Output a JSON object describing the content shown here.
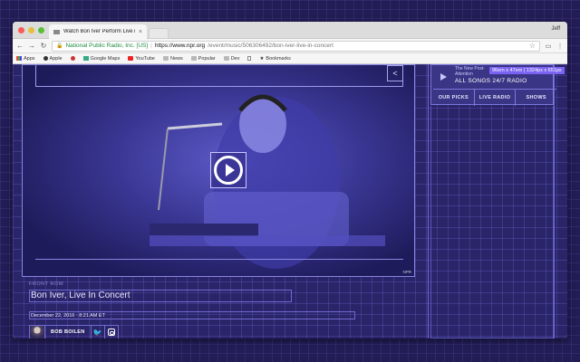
{
  "browser": {
    "tab_title": "Watch Bon Iver Perform Live i",
    "tab_close": "×",
    "user": "Jeff",
    "secure_label": "National Public Radio, Inc. [US]",
    "url_separator": "|",
    "url_host": "https://www.npr.org",
    "url_path": "/event/music/506306492/bon-iver-live-in-concert",
    "bookmarks": [
      {
        "label": "Apps",
        "icon": "apps-icon"
      },
      {
        "label": "Apple",
        "icon": "apple-icon"
      },
      {
        "label": "",
        "icon": "pinterest-icon"
      },
      {
        "label": "Google Maps",
        "icon": "maps-icon"
      },
      {
        "label": "YouTube",
        "icon": "youtube-icon"
      },
      {
        "label": "News",
        "icon": "folder-icon"
      },
      {
        "label": "Popular",
        "icon": "folder-icon"
      },
      {
        "label": "Dev",
        "icon": "folder-icon"
      },
      {
        "label": "",
        "icon": "file-icon"
      },
      {
        "label": "Bookmarks",
        "icon": "star-icon"
      }
    ]
  },
  "video": {
    "credit": "NPR",
    "share_icon": "share-icon",
    "play_icon": "play-icon"
  },
  "article": {
    "kicker": "FRONT ROW",
    "headline": "Bon Iver, Live In Concert",
    "date": "December 22, 2016 · 8:21 AM ET",
    "author": "BOB BOILEN"
  },
  "sidebar": {
    "radio_sub": "The New Post-Attention",
    "radio_name": "ALL SONGS 24/7 RADIO",
    "tooltip": "96em x 47em | 1324px x 651px",
    "nav": [
      "OUR PICKS",
      "LIVE RADIO",
      "SHOWS"
    ]
  },
  "colors": {
    "accent": "#7a63f2",
    "page_bg": "#2a2468",
    "secure": "#1e8e3e"
  }
}
